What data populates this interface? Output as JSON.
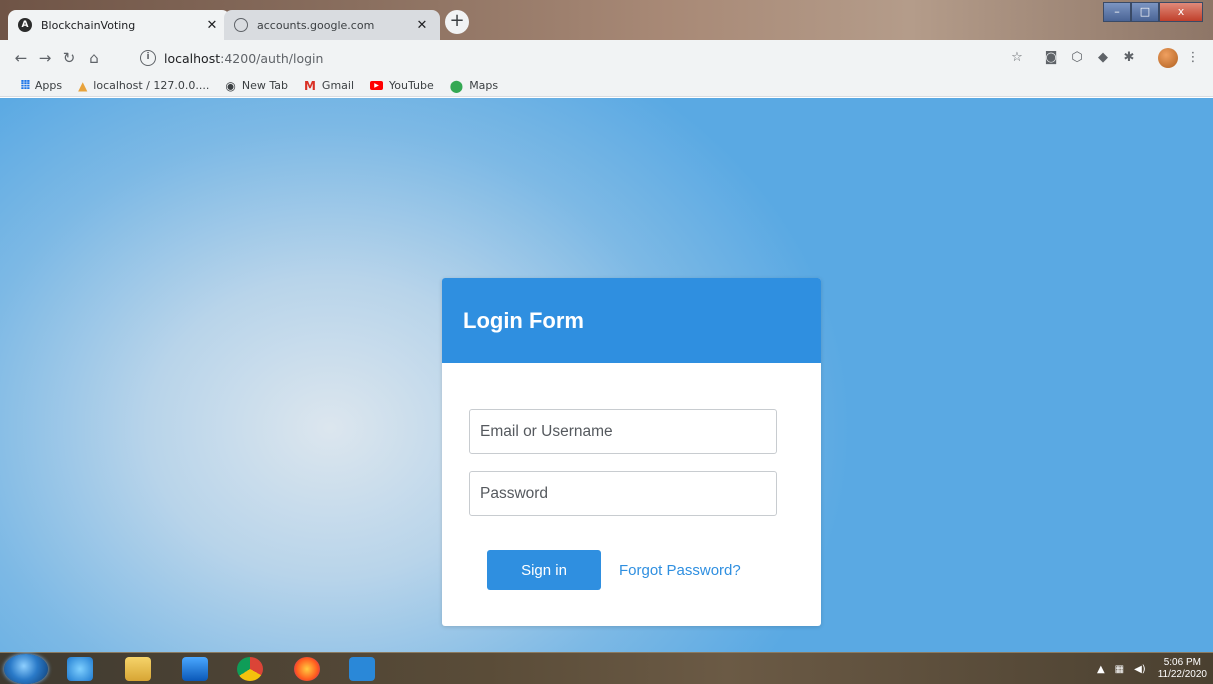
{
  "browser": {
    "tabs": [
      {
        "title": "BlockchainVoting",
        "favicon": "angular-icon",
        "active": true
      },
      {
        "title": "accounts.google.com",
        "favicon": "globe-icon",
        "active": false
      }
    ],
    "new_tab": "+",
    "window_controls": {
      "minimize": "–",
      "maximize": "□",
      "close": "x"
    },
    "url_host": "localhost",
    "url_path": ":4200/auth/login",
    "bookmarks": [
      {
        "label": "Apps",
        "icon": "apps-grid-icon"
      },
      {
        "label": "localhost / 127.0.0....",
        "icon": "phpmyadmin-icon"
      },
      {
        "label": "New Tab",
        "icon": "globe-icon"
      },
      {
        "label": "Gmail",
        "icon": "gmail-icon"
      },
      {
        "label": "YouTube",
        "icon": "youtube-icon"
      },
      {
        "label": "Maps",
        "icon": "maps-pin-icon"
      }
    ]
  },
  "login": {
    "title": "Login Form",
    "email_placeholder": "Email or Username",
    "password_placeholder": "Password",
    "signin_label": "Sign in",
    "forgot_label": "Forgot Password?"
  },
  "taskbar": {
    "time": "5:06 PM",
    "date": "11/22/2020"
  },
  "colors": {
    "accent": "#2f8fe0",
    "background": "#7db9e5"
  }
}
